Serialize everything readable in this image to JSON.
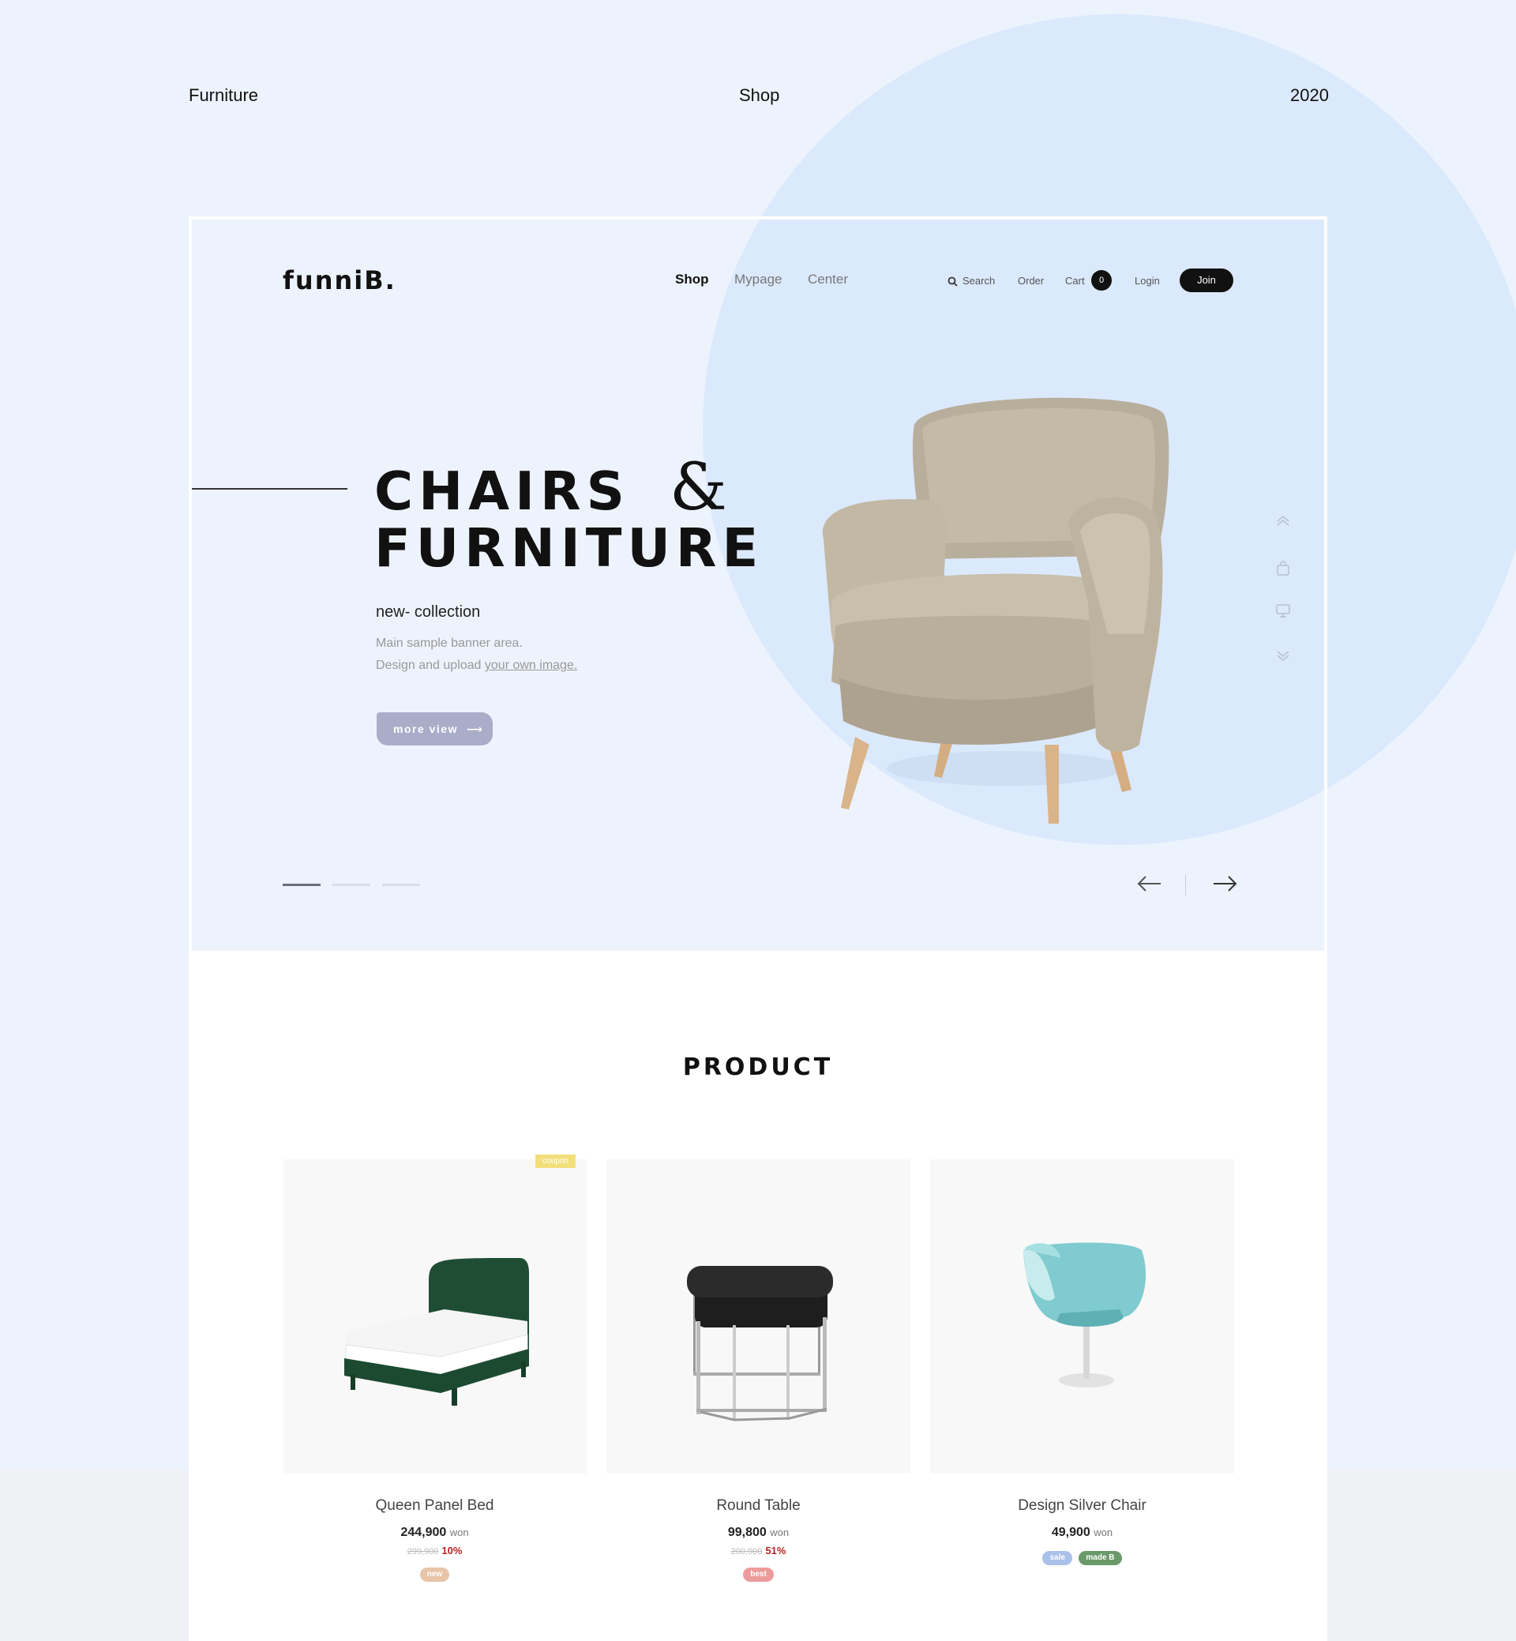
{
  "header": {
    "left": "Furniture",
    "center": "Shop",
    "right": "2020"
  },
  "site": {
    "logo": "funniB."
  },
  "nav": {
    "shop": "Shop",
    "mypage": "Mypage",
    "center": "Center"
  },
  "utility": {
    "search": "Search",
    "order": "Order",
    "cart": "Cart",
    "cart_count": "0",
    "login": "Login",
    "join": "Join"
  },
  "hero": {
    "title_line1": "CHAIRS",
    "amp": "&",
    "title_line2": "FURNITURE",
    "subtitle": "new- collection",
    "desc_line1": "Main sample banner area.",
    "desc_line2": "Design and upload",
    "desc_link": "your own image.",
    "button": "more view",
    "button_arrow": "⟶"
  },
  "product": {
    "section_title": "PRODUCT",
    "items": [
      {
        "name": "Queen Panel Bed",
        "price": "244,900",
        "unit": "won",
        "old_price": "299,900",
        "discount": "10%",
        "badges": [
          "new"
        ],
        "coupon": "coupon"
      },
      {
        "name": "Round Table",
        "price": "99,800",
        "unit": "won",
        "old_price": "200,900",
        "discount": "51%",
        "badges": [
          "best"
        ]
      },
      {
        "name": "Design Silver Chair",
        "price": "49,900",
        "unit": "won",
        "badges": [
          "sale",
          "made B"
        ]
      }
    ]
  },
  "colors": {
    "background": "#edf3fd",
    "circle": "#dbe9fc",
    "button": "#a9adc8",
    "badge_new": "#e8c4a8",
    "badge_best": "#ec9b9b",
    "badge_sale": "#a9c0e9",
    "badge_madeb": "#6a9a6a",
    "coupon": "#f2df7c"
  },
  "icons": {
    "search": "search-icon",
    "up": "double-chevron-up-icon",
    "bag": "bag-icon",
    "monitor": "monitor-icon",
    "down": "double-chevron-down-icon",
    "prev": "arrow-left-icon",
    "next": "arrow-right-icon"
  }
}
